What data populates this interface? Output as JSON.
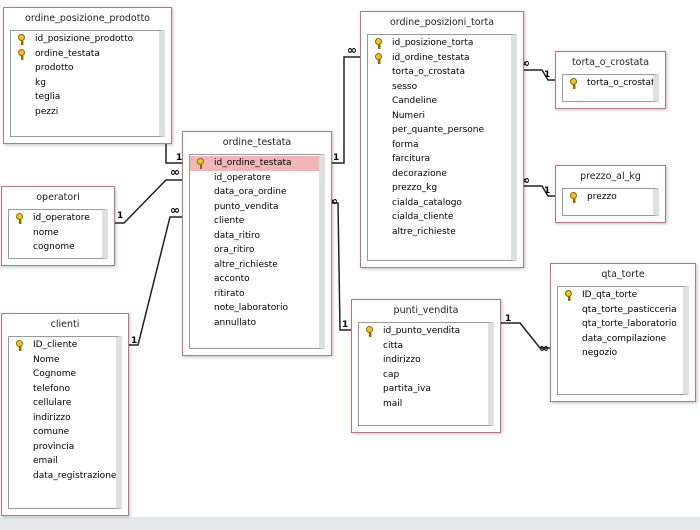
{
  "tables": [
    {
      "name": "ordine_posizione_prodotto",
      "fields": [
        {
          "n": "id_posizione_prodotto",
          "key": true
        },
        {
          "n": "ordine_testata",
          "key": true
        },
        {
          "n": "prodotto"
        },
        {
          "n": "kg"
        },
        {
          "n": "teglia"
        },
        {
          "n": "pezzi"
        }
      ]
    },
    {
      "name": "operatori",
      "fields": [
        {
          "n": "id_operatore",
          "key": true
        },
        {
          "n": "nome"
        },
        {
          "n": "cognome"
        }
      ]
    },
    {
      "name": "clienti",
      "fields": [
        {
          "n": "ID_cliente",
          "key": true
        },
        {
          "n": "Nome"
        },
        {
          "n": "Cognome"
        },
        {
          "n": "telefono"
        },
        {
          "n": "cellulare"
        },
        {
          "n": "indirizzo"
        },
        {
          "n": "comune"
        },
        {
          "n": "provincia"
        },
        {
          "n": "email"
        },
        {
          "n": "data_registrazione"
        }
      ]
    },
    {
      "name": "ordine_testata",
      "fields": [
        {
          "n": "id_ordine_testata",
          "key": true,
          "selected": true
        },
        {
          "n": "id_operatore"
        },
        {
          "n": "data_ora_ordine"
        },
        {
          "n": "punto_vendita"
        },
        {
          "n": "cliente"
        },
        {
          "n": "data_ritiro"
        },
        {
          "n": "ora_ritiro"
        },
        {
          "n": "altre_richieste"
        },
        {
          "n": "acconto"
        },
        {
          "n": "ritirato"
        },
        {
          "n": "note_laboratorio"
        },
        {
          "n": "annullato"
        }
      ]
    },
    {
      "name": "ordine_posizioni_torta",
      "fields": [
        {
          "n": "id_posizione_torta",
          "key": true
        },
        {
          "n": "id_ordine_testata",
          "key": true
        },
        {
          "n": "torta_o_crostata"
        },
        {
          "n": "sesso"
        },
        {
          "n": "Candeline"
        },
        {
          "n": "Numeri"
        },
        {
          "n": "per_quante_persone"
        },
        {
          "n": "forma"
        },
        {
          "n": "farcitura"
        },
        {
          "n": "decorazione"
        },
        {
          "n": "prezzo_kg"
        },
        {
          "n": "cialda_catalogo"
        },
        {
          "n": "cialda_cliente"
        },
        {
          "n": "altre_richieste"
        }
      ]
    },
    {
      "name": "torta_o_crostata",
      "fields": [
        {
          "n": "torta_o_crostata",
          "key": true
        }
      ]
    },
    {
      "name": "prezzo_al_kg",
      "fields": [
        {
          "n": "prezzo",
          "key": true
        }
      ]
    },
    {
      "name": "punti_vendita",
      "fields": [
        {
          "n": "id_punto_vendita",
          "key": true
        },
        {
          "n": "citta"
        },
        {
          "n": "indirizzo"
        },
        {
          "n": "cap"
        },
        {
          "n": "partita_iva"
        },
        {
          "n": "mail"
        }
      ]
    },
    {
      "name": "qta_torte",
      "fields": [
        {
          "n": "ID_qta_torte",
          "key": true
        },
        {
          "n": "qta_torte_pasticceria"
        },
        {
          "n": "qta_torte_laboratorio"
        },
        {
          "n": "data_compilazione"
        },
        {
          "n": "negozio"
        }
      ]
    }
  ],
  "relationships": [
    {
      "one_side": "ordine_testata",
      "many_side": "ordine_posizione_prodotto",
      "one_label": "1",
      "many_label": "∞"
    },
    {
      "one_side": "operatori",
      "many_side": "ordine_testata",
      "one_label": "1",
      "many_label": "∞"
    },
    {
      "one_side": "clienti",
      "many_side": "ordine_testata",
      "one_label": "1",
      "many_label": "∞"
    },
    {
      "one_side": "ordine_testata",
      "many_side": "ordine_posizioni_torta",
      "one_label": "1",
      "many_label": "∞"
    },
    {
      "one_side": "torta_o_crostata",
      "many_side": "ordine_posizioni_torta",
      "one_label": "1",
      "many_label": "∞"
    },
    {
      "one_side": "prezzo_al_kg",
      "many_side": "ordine_posizioni_torta",
      "one_label": "1",
      "many_label": "∞"
    },
    {
      "one_side": "punti_vendita",
      "many_side": "ordine_testata",
      "one_label": "1",
      "many_label": "∞"
    },
    {
      "one_side": "punti_vendita",
      "many_side": "qta_torte",
      "one_label": "1",
      "many_label": "∞"
    }
  ]
}
